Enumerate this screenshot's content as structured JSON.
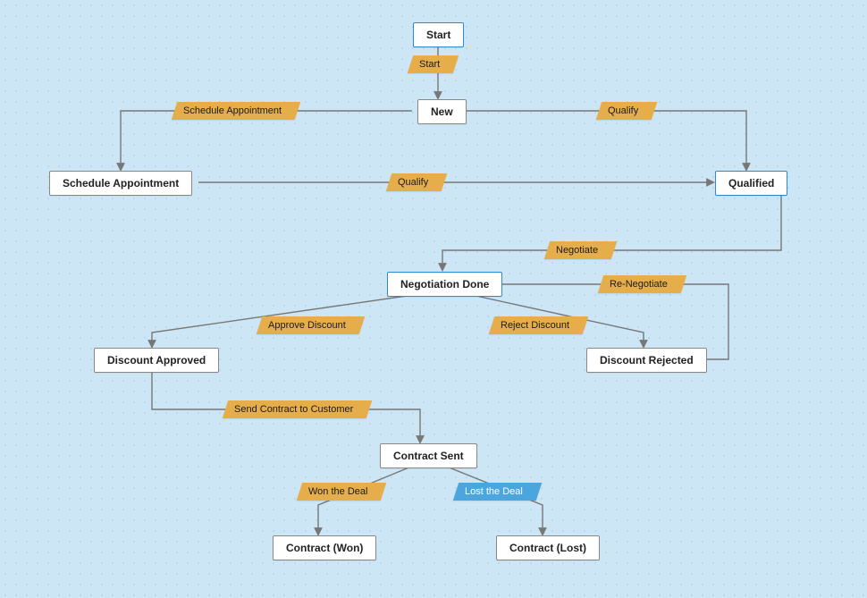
{
  "nodes": {
    "start": "Start",
    "new": "New",
    "schedule_appt": "Schedule Appointment",
    "qualified": "Qualified",
    "negotiation_done": "Negotiation Done",
    "discount_approved": "Discount Approved",
    "discount_rejected": "Discount Rejected",
    "contract_sent": "Contract Sent",
    "contract_won": "Contract (Won)",
    "contract_lost": "Contract (Lost)"
  },
  "edges": {
    "start": "Start",
    "schedule_appointment": "Schedule Appointment",
    "qualify1": "Qualify",
    "qualify2": "Qualify",
    "negotiate": "Negotiate",
    "re_negotiate": "Re-Negotiate",
    "approve_discount": "Approve Discount",
    "reject_discount": "Reject Discount",
    "send_contract": "Send Contract to Customer",
    "won_deal": "Won the Deal",
    "lost_deal": "Lost the Deal"
  }
}
